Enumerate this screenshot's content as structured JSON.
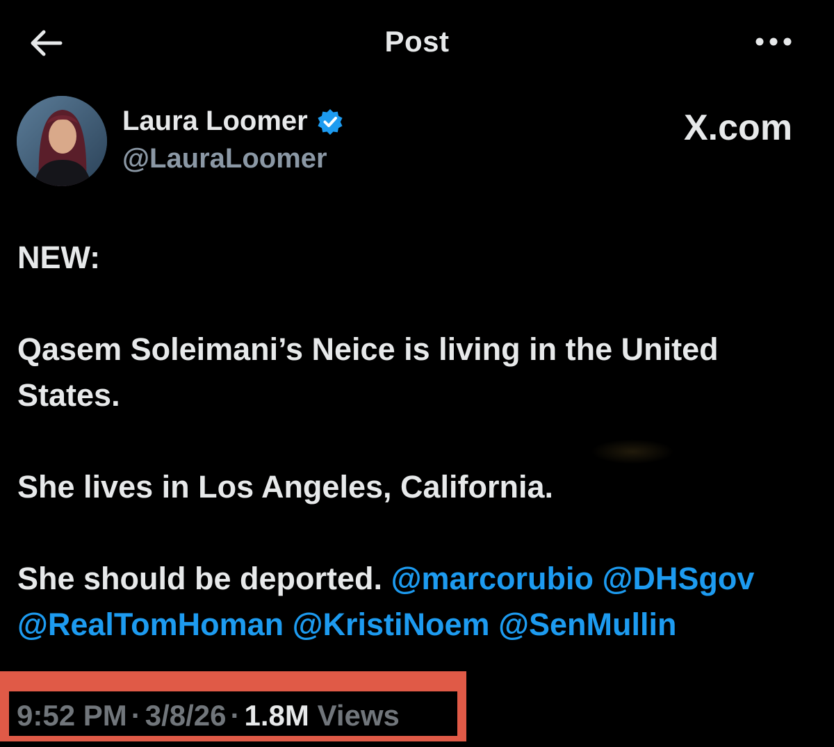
{
  "header": {
    "back_icon": "arrow-left-icon",
    "title": "Post",
    "more_icon": "more-horizontal-icon"
  },
  "author": {
    "name": "Laura Loomer",
    "handle": "@LauraLoomer",
    "verified_icon": "verified-badge-icon",
    "verified_color": "#1d9bf0"
  },
  "watermark": "X.com",
  "post": {
    "line1": "NEW:",
    "line2": "Qasem Soleimani’s Neice is living in the United States.",
    "line3": "She lives in Los Angeles, California.",
    "line4_text": "She should be deported.",
    "mentions": [
      "@marcorubio",
      "@DHSgov",
      "@RealTomHoman",
      "@KristiNoem",
      "@SenMullin"
    ]
  },
  "meta": {
    "time": "9:52 PM",
    "date": "3/8/26",
    "views_count": "1.8M",
    "views_label": "Views",
    "separator": "·"
  },
  "colors": {
    "background": "#000000",
    "text": "#e7e9ea",
    "secondary": "#71767b",
    "link": "#1d9bf0",
    "highlight_box": "#e05a47"
  }
}
